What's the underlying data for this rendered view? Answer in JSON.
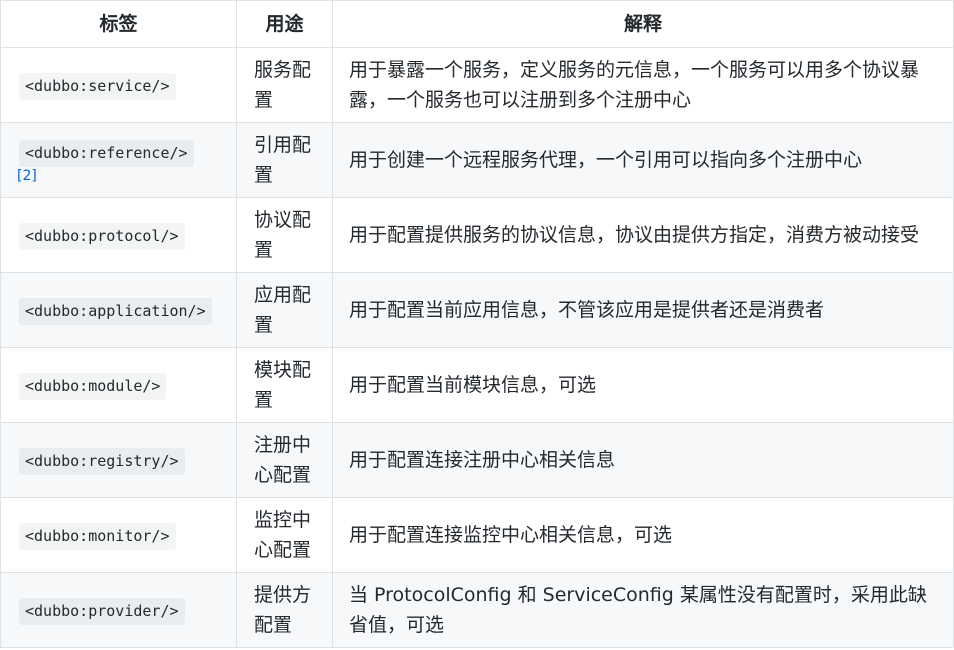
{
  "table": {
    "headers": [
      "标签",
      "用途",
      "解释"
    ],
    "rows": [
      {
        "tag": "<dubbo:service/>",
        "usage": "服务配置",
        "description": "用于暴露一个服务，定义服务的元信息，一个服务可以用多个协议暴露，一个服务也可以注册到多个注册中心"
      },
      {
        "tag": "<dubbo:reference/>",
        "footnote": "[2]",
        "usage": "引用配置",
        "description": "用于创建一个远程服务代理，一个引用可以指向多个注册中心"
      },
      {
        "tag": "<dubbo:protocol/>",
        "usage": "协议配置",
        "description": "用于配置提供服务的协议信息，协议由提供方指定，消费方被动接受"
      },
      {
        "tag": "<dubbo:application/>",
        "usage": "应用配置",
        "description": "用于配置当前应用信息，不管该应用是提供者还是消费者"
      },
      {
        "tag": "<dubbo:module/>",
        "usage": "模块配置",
        "description": "用于配置当前模块信息，可选"
      },
      {
        "tag": "<dubbo:registry/>",
        "usage": "注册中心配置",
        "description": "用于配置连接注册中心相关信息"
      },
      {
        "tag": "<dubbo:monitor/>",
        "usage": "监控中心配置",
        "description": "用于配置连接监控中心相关信息，可选"
      },
      {
        "tag": "<dubbo:provider/>",
        "usage": "提供方配置",
        "description": "当 ProtocolConfig 和 ServiceConfig 某属性没有配置时，采用此缺省值，可选"
      }
    ]
  }
}
